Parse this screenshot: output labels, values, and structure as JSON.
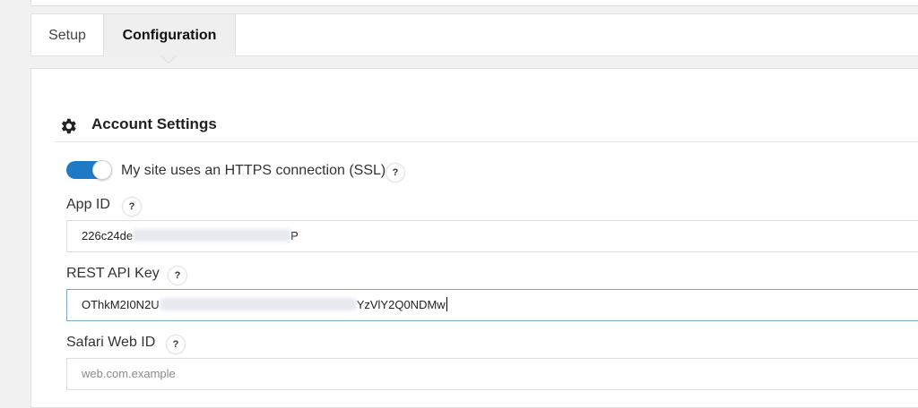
{
  "tabs": {
    "setup": "Setup",
    "configuration": "Configuration"
  },
  "section": {
    "title": "Account Settings",
    "icon": "gear-icon"
  },
  "ssl_toggle": {
    "label": "My site uses an HTTPS connection (SSL)",
    "state": "on"
  },
  "fields": {
    "app_id": {
      "label": "App ID",
      "value_start": "226c24de",
      "value_end": "P"
    },
    "rest_api_key": {
      "label": "REST API Key",
      "value_start": "OThkM2I0N2U",
      "value_end": "YzVlY2Q0NDMw"
    },
    "safari_web_id": {
      "label": "Safari Web ID",
      "placeholder": "web.com.example"
    }
  },
  "help_glyph": "?",
  "colors": {
    "toggle_on": "#1f7ac6",
    "active_tab_bg": "#efefef",
    "focus_border": "#7fa9c9"
  }
}
